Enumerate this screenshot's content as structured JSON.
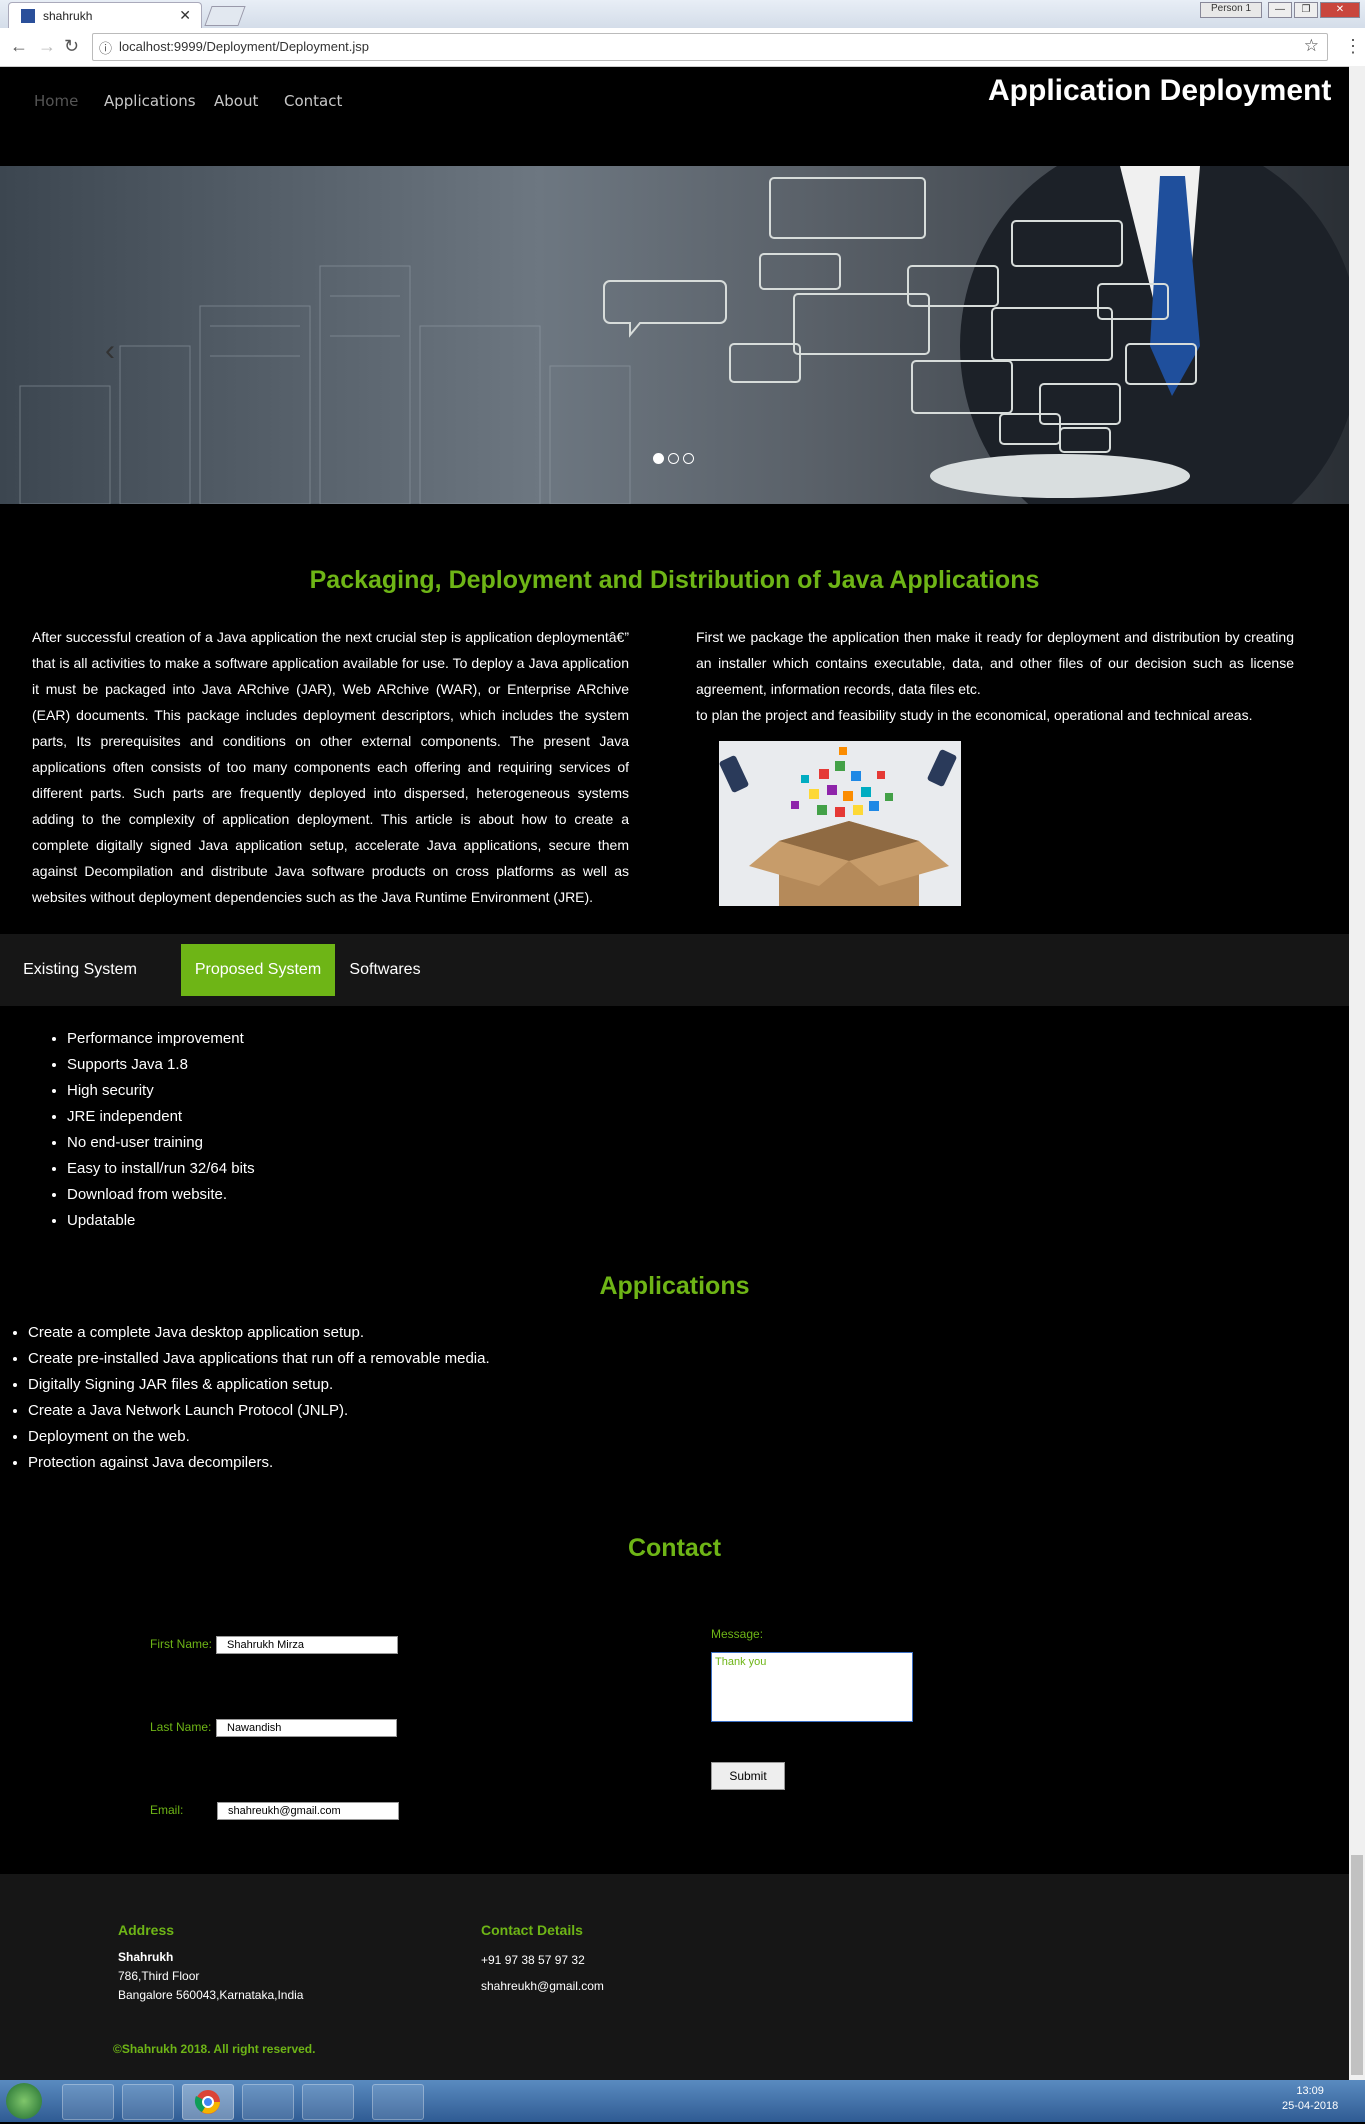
{
  "browser": {
    "tab_title": "shahrukh",
    "close_glyph": "✕",
    "profile_label": "Person 1",
    "win_controls": [
      "—",
      "❐",
      "✕"
    ],
    "back_glyph": "←",
    "forward_glyph": "→",
    "reload_glyph": "↻",
    "info_glyph": "ⓘ",
    "url": "localhost:9999/Deployment/Deployment.jsp",
    "star_glyph": "☆",
    "menu_glyph": "⋮"
  },
  "nav": {
    "items": [
      "Home",
      "Applications",
      "About",
      "Contact"
    ],
    "site_title": "Application Deployment"
  },
  "hero": {
    "prev_glyph": "‹",
    "active_slide": 1,
    "slide_count": 3
  },
  "intro": {
    "title": "Packaging, Deployment and Distribution of Java Applications",
    "left_text": "After successful creation of a Java application the next crucial step is application deploymentâ€” that is all activities to make a software application available for use. To deploy a Java application it must be packaged into Java ARchive (JAR), Web ARchive (WAR), or Enterprise ARchive (EAR) documents. This package includes deployment descriptors, which includes the system parts, Its prerequisites and conditions on other external components. The present Java applications often consists of too many components each offering and requiring services of different parts. Such parts are frequently deployed into dispersed, heterogeneous systems adding to the complexity of application deployment. This article is about how to create a complete digitally signed Java application setup, accelerate Java applications, secure them against Decompilation and distribute Java software products on cross platforms as well as websites without deployment dependencies such as the Java Runtime Environment (JRE).",
    "right_text": "First we package the application then make it ready for deployment and distribution by creating an installer which contains executable, data, and other files of our decision such as license agreement, information records, data files etc.",
    "right_text2": "to plan the project and feasibility study in the economical, operational and technical areas."
  },
  "tabs": {
    "items": [
      "Existing System",
      "Proposed System",
      "Softwares"
    ],
    "active": "Proposed System",
    "features": [
      "Performance improvement",
      "Supports Java 1.8",
      "High security",
      "JRE independent",
      "No end-user training",
      "Easy to install/run 32/64 bits",
      "Download from website.",
      "Updatable"
    ]
  },
  "applications": {
    "title": "Applications",
    "items": [
      "Create a complete Java desktop application setup.",
      "Create pre-installed Java applications that run off a removable media.",
      "Digitally Signing JAR files & application setup.",
      "Create a Java Network Launch Protocol (JNLP).",
      "Deployment on the web.",
      "Protection against Java decompilers."
    ]
  },
  "contact": {
    "title": "Contact",
    "first_name_label": "First Name:",
    "first_name_value": "Shahrukh Mirza",
    "last_name_label": "Last Name:",
    "last_name_value": "Nawandish",
    "email_label": "Email:",
    "email_value": "shahreukh@gmail.com",
    "message_label": "Message:",
    "message_value": "Thank you",
    "submit_label": "Submit"
  },
  "footer": {
    "address_heading": "Address",
    "address_name": "Shahrukh",
    "address_line1": "786,Third Floor",
    "address_line2": "Bangalore 560043,Karnataka,India",
    "contact_heading": "Contact Details",
    "phone": "+91 97 38 57 97 32",
    "email": "shahreukh@gmail.com",
    "copyright": "©Shahrukh 2018. All right reserved."
  },
  "taskbar": {
    "time": "13:09",
    "date": "25-04-2018"
  },
  "colors": {
    "accent": "#6eb516",
    "page_bg": "#000000",
    "tab_bar_bg": "#161616"
  }
}
